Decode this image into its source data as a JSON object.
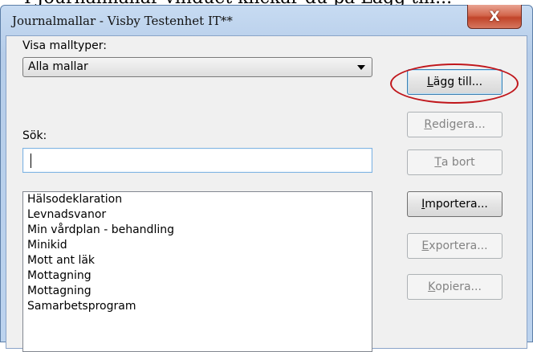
{
  "caption_text": "I Journalmallar vinduet klickar du på Lägg till...",
  "window": {
    "title": "Journalmallar - Visby Testenhet IT**",
    "close_glyph": "X"
  },
  "filter": {
    "label": "Visa malltyper:",
    "selected": "Alla mallar"
  },
  "search": {
    "label": "Sök:",
    "value": ""
  },
  "templates": [
    "Hälsodeklaration",
    "Levnadsvanor",
    "Min vårdplan - behandling",
    "Minikid",
    "Mott ant läk",
    "Mottagning",
    "Mottagning",
    "Samarbetsprogram"
  ],
  "buttons": {
    "add": {
      "mnemonic": "L",
      "rest": "ägg till...",
      "enabled": true
    },
    "edit": {
      "mnemonic": "R",
      "rest": "edigera...",
      "enabled": false
    },
    "delete": {
      "mnemonic": "T",
      "rest": "a bort",
      "enabled": false
    },
    "import": {
      "mnemonic": "I",
      "rest": "mportera...",
      "enabled": true
    },
    "export": {
      "mnemonic": "E",
      "rest": "xportera...",
      "enabled": false
    },
    "copy": {
      "mnemonic": "K",
      "rest": "opiera...",
      "enabled": false
    }
  },
  "colors": {
    "highlight": "#c0161b",
    "close_button": "#c1442a"
  }
}
